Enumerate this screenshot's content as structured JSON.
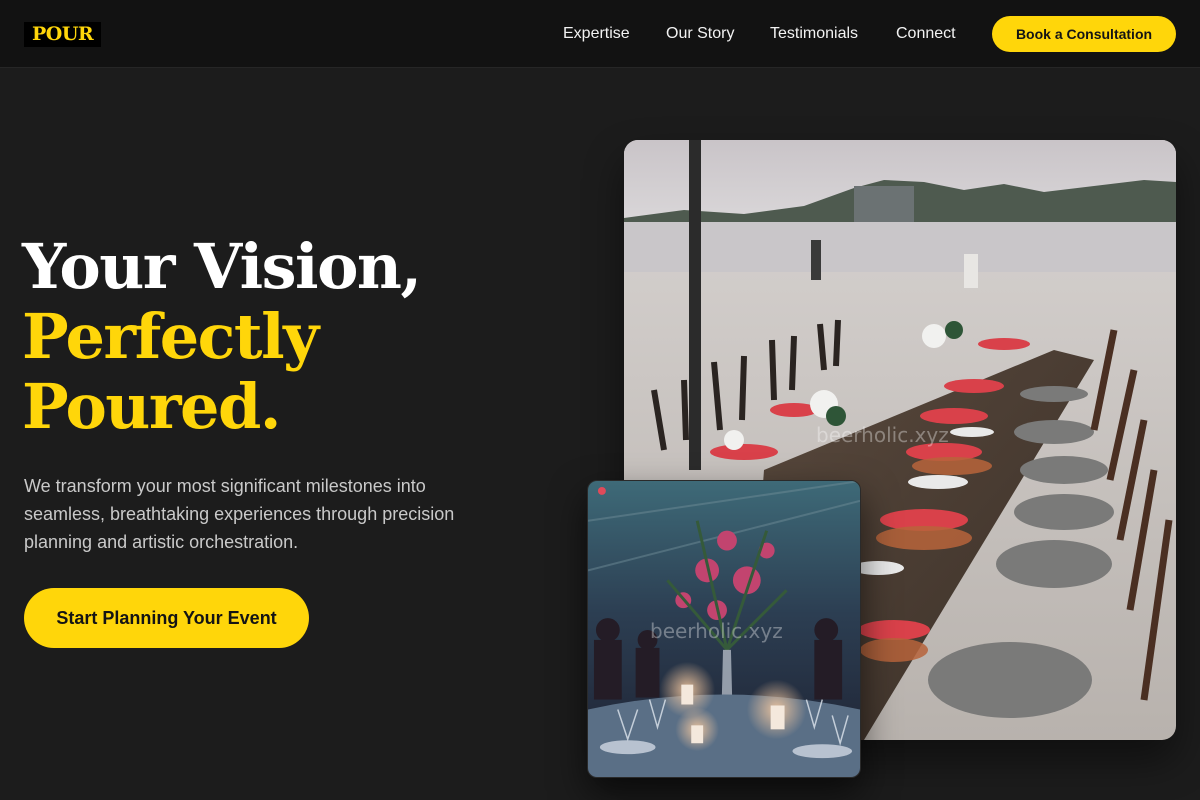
{
  "brand": {
    "logo_text": "POUR"
  },
  "nav": {
    "links": [
      "Expertise",
      "Our Story",
      "Testimonials",
      "Connect"
    ],
    "cta_label": "Book a Consultation"
  },
  "hero": {
    "headline_line1": "Your Vision,",
    "headline_line2": "Perfectly",
    "headline_line3": "Poured.",
    "intro": "We transform your most significant milestones into seamless, breathtaking experiences through precision planning and artistic orchestration.",
    "cta_label": "Start Planning Your Event"
  },
  "images": {
    "main": {
      "description_icon": "beach-dinner-table-photo",
      "watermark": "beerholic.xyz"
    },
    "secondary": {
      "description_icon": "candlelit-banquet-photo",
      "watermark": "beerholic.xyz"
    }
  },
  "colors": {
    "accent": "#ffd60a",
    "background": "#1c1c1c",
    "header": "#121212",
    "text_muted": "#c9c9c9"
  }
}
